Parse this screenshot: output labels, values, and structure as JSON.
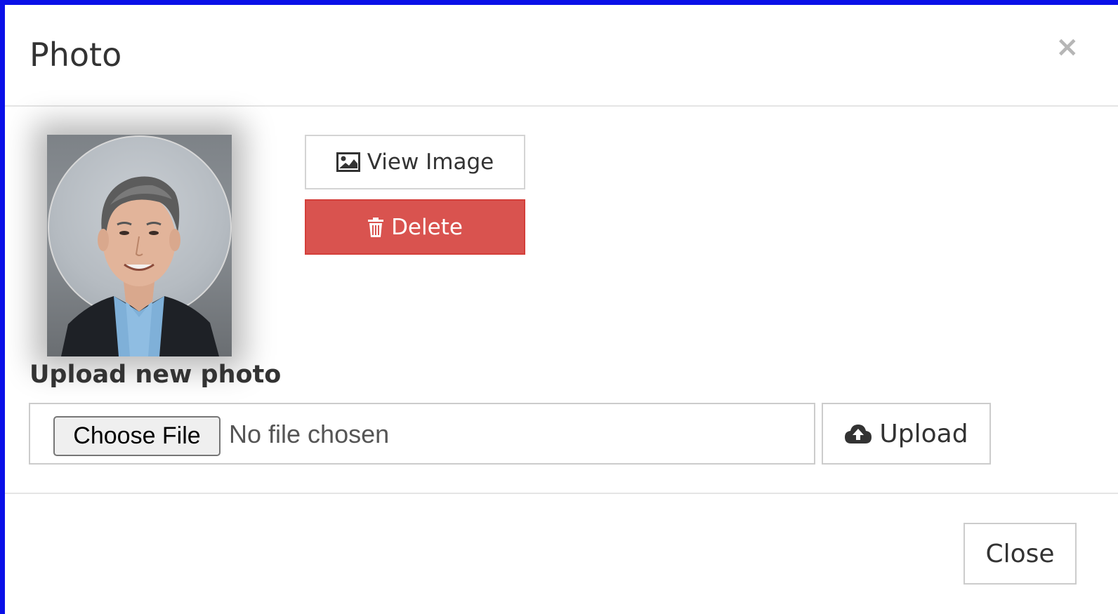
{
  "modal": {
    "title": "Photo",
    "close_icon": "close-icon",
    "close_glyph": "×"
  },
  "photo": {
    "description_icon": "profile-photo"
  },
  "actions": {
    "view_image_label": "View Image",
    "view_image_icon": "image-icon",
    "delete_label": "Delete",
    "delete_icon": "trash-icon"
  },
  "upload": {
    "label": "Upload new photo",
    "choose_file_label": "Choose File",
    "file_status": "No file chosen",
    "upload_label": "Upload",
    "upload_icon": "cloud-upload-icon"
  },
  "footer": {
    "close_label": "Close"
  },
  "colors": {
    "frame": "#0a10e8",
    "danger": "#d9534f",
    "text": "#333333",
    "border": "#cccccc"
  }
}
